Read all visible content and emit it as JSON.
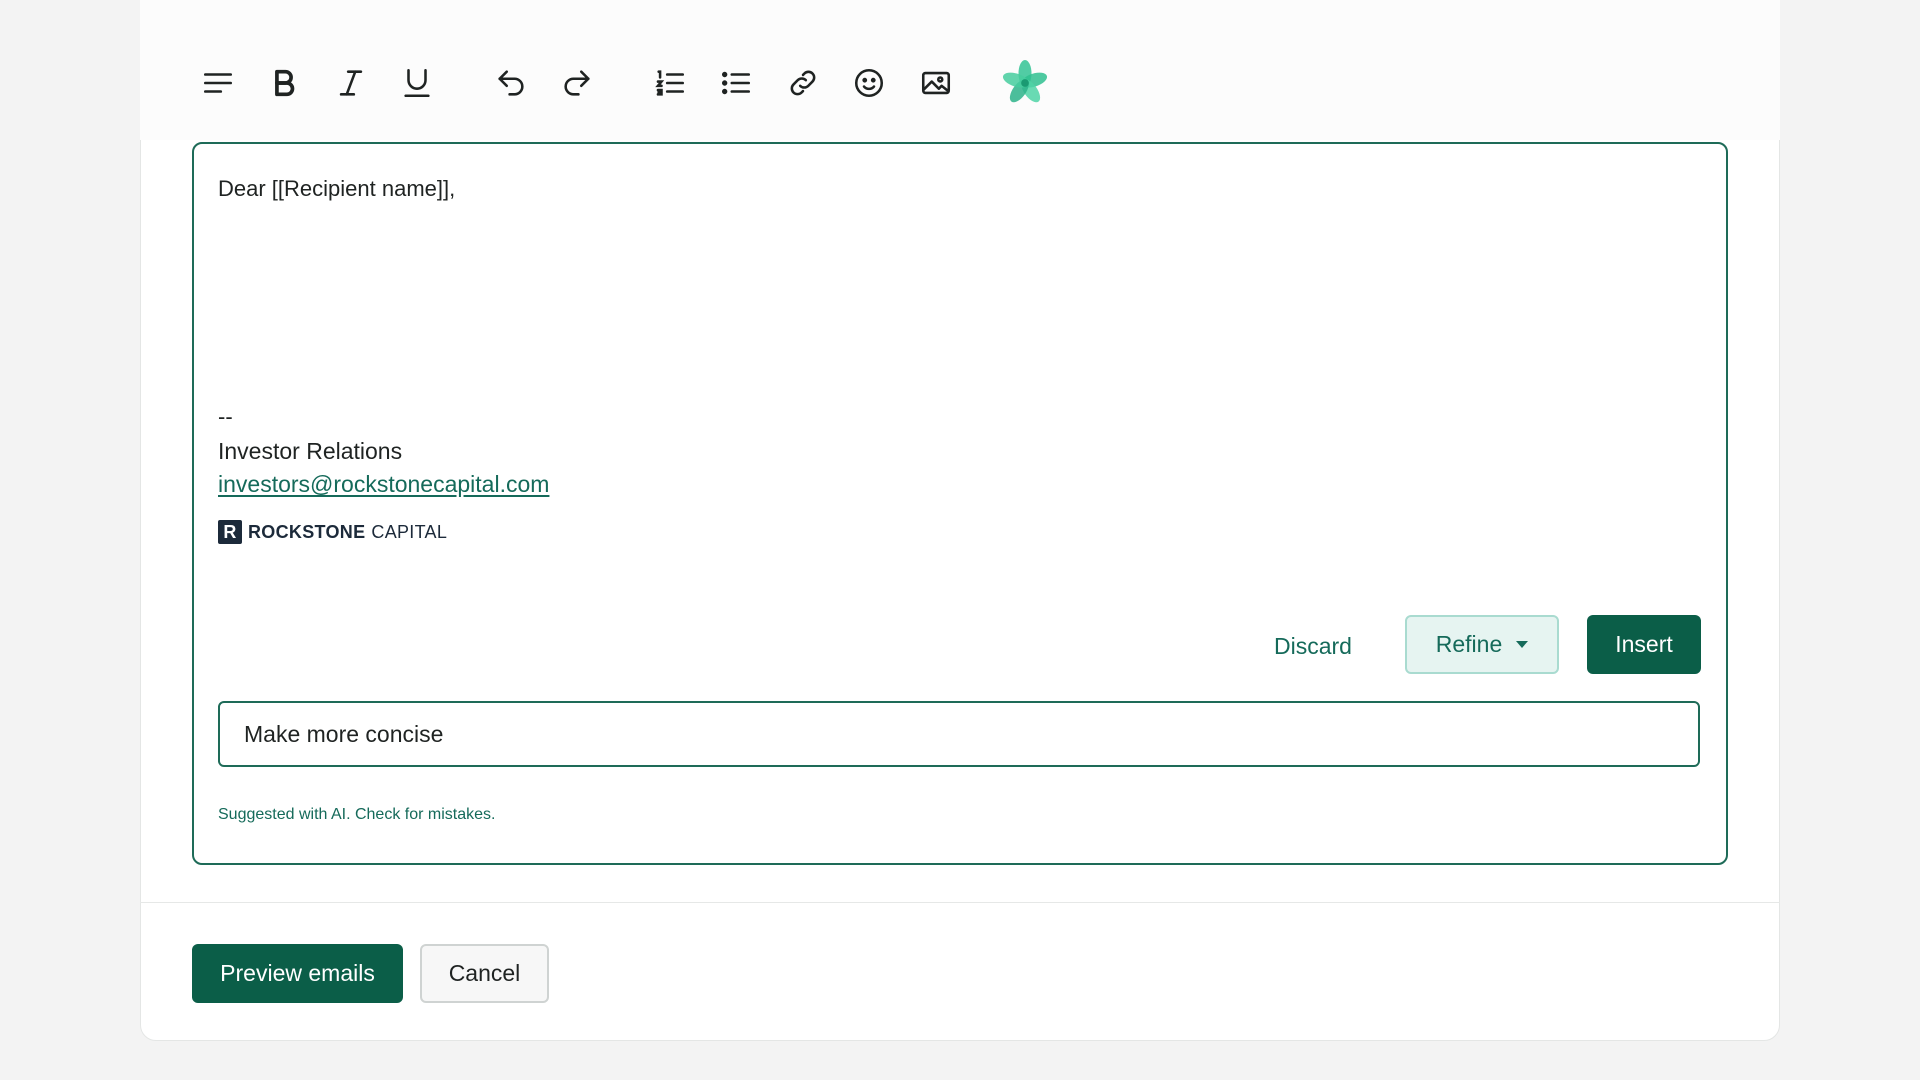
{
  "toolbar": {
    "icons": [
      "paragraph-icon",
      "bold-icon",
      "italic-icon",
      "underline-icon",
      "undo-icon",
      "redo-icon",
      "numbered-list-icon",
      "bulleted-list-icon",
      "link-icon",
      "emoji-icon",
      "image-icon",
      "ai-flower-icon"
    ]
  },
  "editor": {
    "greeting": "Dear [[Recipient name]],",
    "signature": {
      "separator": "--",
      "name": "Investor Relations",
      "email": "investors@rockstonecapital.com",
      "logo_mark": "R",
      "logo_bold": "ROCKSTONE",
      "logo_light": "CAPITAL"
    }
  },
  "ai_panel": {
    "discard_label": "Discard",
    "refine_label": "Refine",
    "insert_label": "Insert",
    "prompt_value": "Make more concise",
    "disclaimer": "Suggested with AI. Check for mistakes."
  },
  "footer": {
    "preview_label": "Preview emails",
    "cancel_label": "Cancel"
  },
  "colors": {
    "brand_green": "#0b5e48",
    "accent_teal": "#156a5a",
    "refine_bg": "#e6f4f1",
    "ai_icon": "#3ec79a"
  }
}
